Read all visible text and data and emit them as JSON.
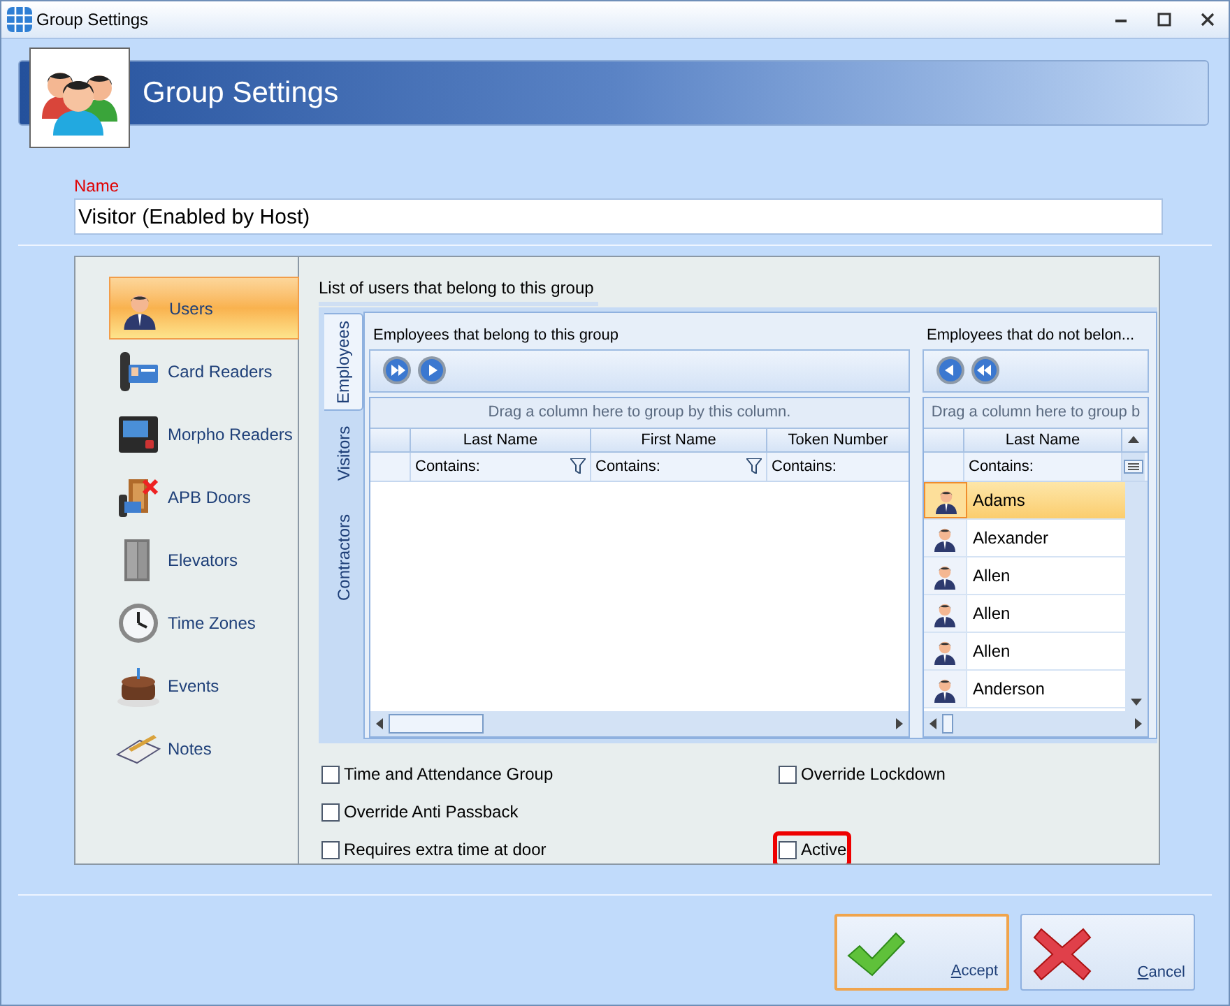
{
  "window": {
    "title": "Group Settings"
  },
  "header": {
    "title": "Group Settings"
  },
  "name_field": {
    "label": "Name",
    "value": "Visitor (Enabled by Host)"
  },
  "sidebar": {
    "items": [
      {
        "label": "Users",
        "selected": true
      },
      {
        "label": "Card Readers",
        "selected": false
      },
      {
        "label": "Morpho Readers",
        "selected": false
      },
      {
        "label": "APB Doors",
        "selected": false
      },
      {
        "label": "Elevators",
        "selected": false
      },
      {
        "label": "Time Zones",
        "selected": false
      },
      {
        "label": "Events",
        "selected": false
      },
      {
        "label": "Notes",
        "selected": false
      }
    ]
  },
  "users_panel": {
    "title": "List of users that belong to this group",
    "tabs": [
      {
        "label": "Employees",
        "selected": true
      },
      {
        "label": "Visitors",
        "selected": false
      },
      {
        "label": "Contractors",
        "selected": false
      }
    ],
    "members": {
      "title": "Employees that belong to this group",
      "group_hint": "Drag a column here to group by this column.",
      "columns": [
        {
          "header": "Last Name",
          "filter": "Contains:"
        },
        {
          "header": "First Name",
          "filter": "Contains:"
        },
        {
          "header": "Token Number",
          "filter": "Contains:"
        }
      ]
    },
    "non_members": {
      "title": "Employees that do not belon...",
      "group_hint": "Drag a column here to group b",
      "columns": [
        {
          "header": "Last Name",
          "filter": "Contains:"
        }
      ],
      "rows": [
        {
          "last_name": "Adams",
          "selected": true
        },
        {
          "last_name": "Alexander",
          "selected": false
        },
        {
          "last_name": "Allen",
          "selected": false
        },
        {
          "last_name": "Allen",
          "selected": false
        },
        {
          "last_name": "Allen",
          "selected": false
        },
        {
          "last_name": "Anderson",
          "selected": false
        }
      ]
    }
  },
  "options": [
    {
      "label": "Time and Attendance Group",
      "checked": false,
      "highlighted": false
    },
    {
      "label": "Override Anti Passback",
      "checked": false,
      "highlighted": false
    },
    {
      "label": "Requires extra time at door",
      "checked": false,
      "highlighted": false
    },
    {
      "label": "Override Lockdown",
      "checked": false,
      "highlighted": false
    },
    {
      "label": "Active",
      "checked": false,
      "highlighted": true
    }
  ],
  "buttons": [
    {
      "label": "Accept",
      "kind": "accept",
      "focused": true
    },
    {
      "label": "Cancel",
      "kind": "cancel",
      "focused": false
    }
  ]
}
